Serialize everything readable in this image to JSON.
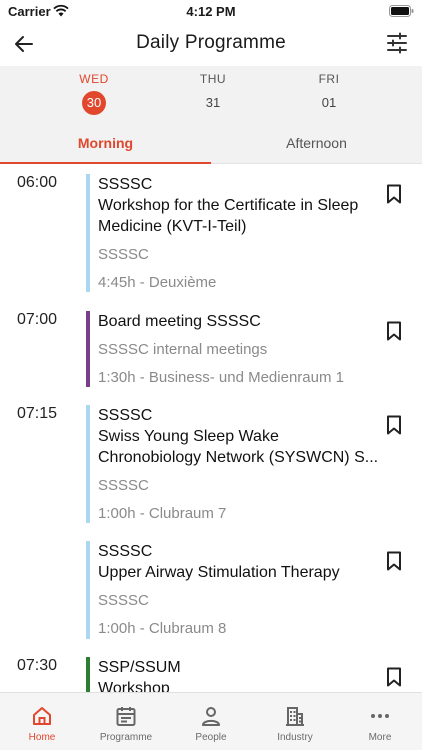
{
  "status_bar": {
    "carrier": "Carrier",
    "time": "4:12 PM"
  },
  "header": {
    "title": "Daily Programme"
  },
  "days": [
    {
      "name": "WED",
      "num": "30",
      "active": true
    },
    {
      "name": "THU",
      "num": "31",
      "active": false
    },
    {
      "name": "FRI",
      "num": "01",
      "active": false
    }
  ],
  "tabs": [
    {
      "label": "Morning",
      "active": true
    },
    {
      "label": "Afternoon",
      "active": false
    }
  ],
  "sessions": [
    {
      "time": "06:00",
      "title": "SSSSC\nWorkshop for the Certificate in Sleep Medicine  (KVT-I-Teil)",
      "subtitle": "SSSSC",
      "room": "4:45h - Deuxième",
      "color": "#a9d8f0"
    },
    {
      "time": "07:00",
      "title": "Board meeting SSSSC",
      "subtitle": "SSSSC internal meetings",
      "room": "1:30h - Business- und Medienraum 1",
      "color": "#7b3f8a"
    },
    {
      "time": "07:15",
      "title": "SSSSC\nSwiss Young Sleep Wake Chronobiology Network (SYSWCN) S...",
      "subtitle": "SSSSC",
      "room": "1:00h - Clubraum 7",
      "color": "#a9d8f0"
    },
    {
      "time": "",
      "title": "SSSSC\nUpper Airway Stimulation Therapy",
      "subtitle": "SSSSC",
      "room": "1:00h - Clubraum 8",
      "color": "#a9d8f0"
    },
    {
      "time": "07:30",
      "title": "SSP/SSUM\nWorkshop",
      "subtitle": "",
      "room": "",
      "color": "#2e7d32"
    }
  ],
  "tabbar": [
    {
      "label": "Home",
      "icon": "home-icon",
      "active": true
    },
    {
      "label": "Programme",
      "icon": "calendar-icon",
      "active": false
    },
    {
      "label": "People",
      "icon": "person-icon",
      "active": false
    },
    {
      "label": "Industry",
      "icon": "building-icon",
      "active": false
    },
    {
      "label": "More",
      "icon": "more-icon",
      "active": false
    }
  ],
  "colors": {
    "accent": "#e0472d"
  }
}
